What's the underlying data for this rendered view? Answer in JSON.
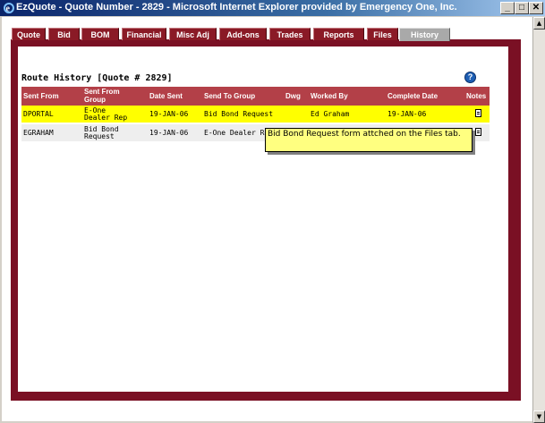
{
  "window": {
    "title": "EzQuote - Quote Number - 2829 - Microsoft Internet Explorer provided by Emergency One, Inc.",
    "minimize_glyph": "_",
    "maximize_glyph": "□",
    "close_glyph": "✕"
  },
  "tabs": [
    {
      "label": "Quote"
    },
    {
      "label": "Bid"
    },
    {
      "label": "BOM"
    },
    {
      "label": "Financial"
    },
    {
      "label": "Misc Adj"
    },
    {
      "label": "Add-ons"
    },
    {
      "label": "Trades"
    },
    {
      "label": "Reports"
    },
    {
      "label": "Files"
    },
    {
      "label": "History",
      "active": true
    }
  ],
  "route_history": {
    "heading": "Route History [Quote # 2829]",
    "help_glyph": "?",
    "columns": [
      "Sent From",
      "Sent From Group",
      "Date Sent",
      "Send To Group",
      "Dwg",
      "Worked By",
      "Complete Date",
      "Notes"
    ],
    "rows": [
      {
        "sent_from": "DPORTAL",
        "sent_from_group": "E-One Dealer Rep",
        "date_sent": "19-JAN-06",
        "send_to_group": "Bid Bond Request",
        "dwg": "",
        "worked_by": "Ed Graham",
        "complete_date": "19-JAN-06",
        "has_note": true,
        "highlighted": true
      },
      {
        "sent_from": "EGRAHAM",
        "sent_from_group": "Bid Bond Request",
        "date_sent": "19-JAN-06",
        "send_to_group": "E-One Dealer Re",
        "dwg": "",
        "worked_by": "",
        "complete_date": "",
        "has_note": true,
        "highlighted": false
      }
    ]
  },
  "tooltip": {
    "text": "Bid Bond Request form attched on the Files tab."
  },
  "colors": {
    "titlebar": "#0a246a",
    "tab": "#8a1a26",
    "tab_active": "#a9a9a9",
    "panel_border": "#7a1024",
    "table_header": "#b34048",
    "row_highlight": "#ffff00",
    "tooltip_bg": "#ffff80"
  }
}
